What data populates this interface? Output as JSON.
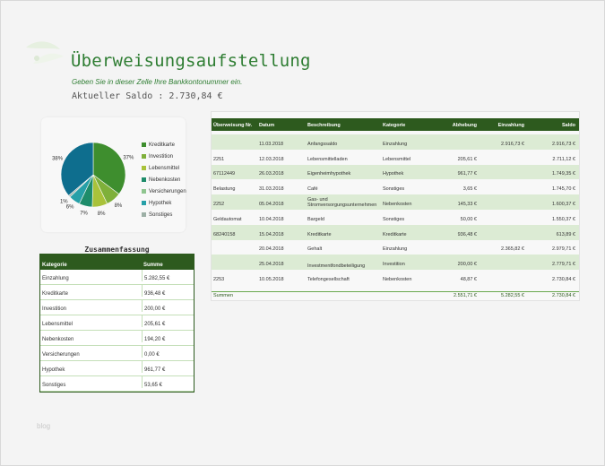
{
  "header": {
    "title": "Überweisungsaufstellung",
    "subtitle": "Geben Sie in dieser Zelle Ihre Bankkontonummer ein.",
    "saldo": "Aktueller Saldo : 2.730,84 €"
  },
  "colors": {
    "dark_green": "#2d5a1e",
    "title_green": "#2e7d32",
    "row_alt": "#dcebd4"
  },
  "chart_data": {
    "type": "pie",
    "title": "",
    "slices": [
      {
        "label": "Kreditkarte",
        "value": 37,
        "color": "#3e8e2e",
        "text": "37%"
      },
      {
        "label": "Investition",
        "value": 8,
        "color": "#7fb03a",
        "text": "8%"
      },
      {
        "label": "Lebensmittel",
        "value": 8,
        "color": "#a9c23a",
        "text": "8%"
      },
      {
        "label": "Nebenkosten",
        "value": 7,
        "color": "#1e8c6a",
        "text": "7%"
      },
      {
        "label": "Versicherungen",
        "value": 0,
        "color": "#8fc58f",
        "text": ""
      },
      {
        "label": "Hypothek",
        "value": 6,
        "color": "#27a0a8",
        "text": "6%"
      },
      {
        "label": "Sonstiges",
        "value": 1,
        "color": "#9db0a6",
        "text": "1%"
      },
      {
        "label": "Einzahlung",
        "value": 38,
        "color": "#0e6e8e",
        "text": "38%"
      }
    ],
    "legend": [
      "Kreditkarte",
      "Investition",
      "Lebensmittel",
      "Nebenkosten",
      "Versicherungen",
      "Hypothek",
      "Sonstiges"
    ],
    "legend_position": "right"
  },
  "summary": {
    "title": "Zusammenfassung",
    "headers": [
      "Kategorie",
      "Summe"
    ],
    "rows": [
      [
        "Einzahlung",
        "5.282,55 €"
      ],
      [
        "Kreditkarte",
        "936,48 €"
      ],
      [
        "Investition",
        "200,00 €"
      ],
      [
        "Lebensmittel",
        "205,61 €"
      ],
      [
        "Nebenkosten",
        "194,20 €"
      ],
      [
        "Versicherungen",
        "0,00 €"
      ],
      [
        "Hypothek",
        "961,77 €"
      ],
      [
        "Sonstiges",
        "53,65 €"
      ]
    ]
  },
  "table": {
    "headers": [
      "Überweisung Nr.",
      "Datum",
      "Beschreibung",
      "Kategorie",
      "Abhebung",
      "Einzahlung",
      "Saldo"
    ],
    "rows": [
      [
        "",
        "11.03.2018",
        "Anfangssaldo",
        "Einzahlung",
        "",
        "2.916,73 €",
        "2.916,73 €"
      ],
      [
        "2251",
        "12.03.2018",
        "Lebensmittelladen",
        "Lebensmittel",
        "205,61 €",
        "",
        "2.711,12 €"
      ],
      [
        "67112449",
        "26.03.2018",
        "Eigenheimhypothek",
        "Hypothek",
        "961,77 €",
        "",
        "1.749,35 €"
      ],
      [
        "Belastung",
        "31.03.2018",
        "Café",
        "Sonstiges",
        "3,65 €",
        "",
        "1.745,70 €"
      ],
      [
        "2252",
        "05.04.2018",
        "Gas- und Stromversorgungsunternehmen",
        "Nebenkosten",
        "145,33 €",
        "",
        "1.600,37 €"
      ],
      [
        "Geldautomat",
        "10.04.2018",
        "Bargeld",
        "Sonstiges",
        "50,00 €",
        "",
        "1.550,37 €"
      ],
      [
        "68240158",
        "15.04.2018",
        "Kreditkarte",
        "Kreditkarte",
        "936,48 €",
        "",
        "613,89 €"
      ],
      [
        "",
        "20.04.2018",
        "Gehalt",
        "Einzahlung",
        "",
        "2.365,82 €",
        "2.979,71 €"
      ],
      [
        "",
        "25.04.2018",
        "Investmentfondbeteiligung",
        "Investition",
        "200,00 €",
        "",
        "2.779,71 €"
      ],
      [
        "2253",
        "10.05.2018",
        "Telefongesellschaft",
        "Nebenkosten",
        "48,87 €",
        "",
        "2.730,84 €"
      ]
    ],
    "sum_row": [
      "Summen",
      "",
      "",
      "",
      "2.551,71 €",
      "5.282,55 €",
      "2.730,84 €"
    ]
  },
  "footer": {
    "watermark": "blog"
  }
}
